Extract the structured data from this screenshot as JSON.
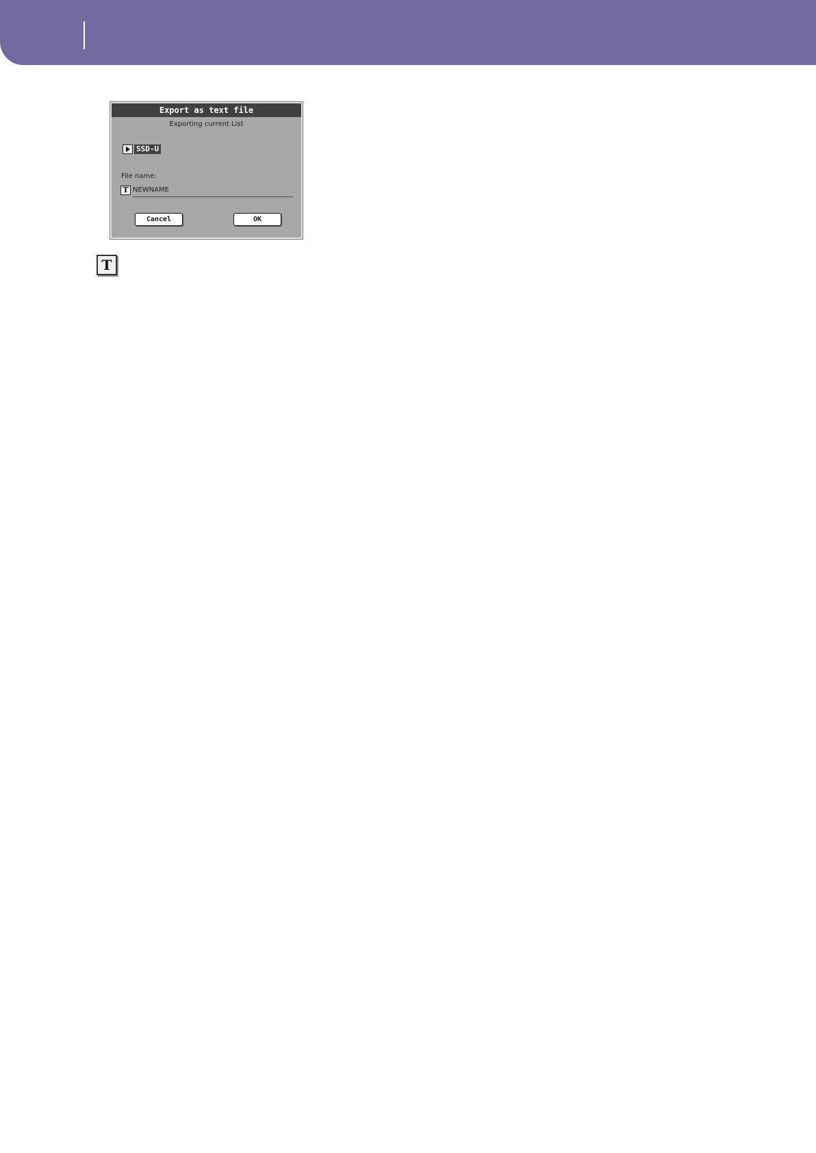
{
  "colors": {
    "header_band": "#716a9f",
    "dialog_bg": "#a7a7a7",
    "titlebar_bg": "#404040"
  },
  "dialog": {
    "title": "Export as text file",
    "subtitle": "Exporting current List",
    "device": {
      "icon": "play-arrow-icon",
      "label": "SSD-U"
    },
    "file_name_label": "File name:",
    "file_name_icon_glyph": "T",
    "file_name_value": "NEWNAME",
    "cancel_label": "Cancel",
    "ok_label": "OK"
  },
  "text_edit_icon": {
    "icon": "text-edit-icon",
    "glyph": "T"
  }
}
